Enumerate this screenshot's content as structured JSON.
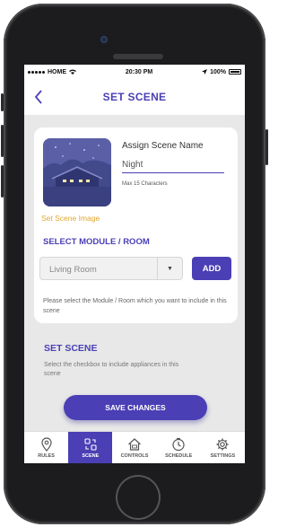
{
  "status_bar": {
    "carrier": "HOME",
    "time": "20:30 PM",
    "battery": "100%"
  },
  "header": {
    "title": "SET SCENE",
    "back_icon": "chevron-left-icon"
  },
  "scene_card": {
    "image_label": "Set Scene Image",
    "assign_label": "Assign Scene Name",
    "name_value": "Night",
    "max_hint": "Max 15 Characters",
    "module_heading": "SELECT MODULE / ROOM",
    "room_selected": "Living Room",
    "add_label": "ADD",
    "hint": "Please select the Module / Room which you want to include in this scene"
  },
  "set_scene": {
    "heading": "SET SCENE",
    "hint": "Select the checkbox to include appliances in this scene"
  },
  "save_label": "SAVE CHANGES",
  "tabs": [
    {
      "label": "RULES",
      "icon": "map-pin-icon",
      "active": false
    },
    {
      "label": "SCENE",
      "icon": "scene-icon",
      "active": true
    },
    {
      "label": "CONTROLS",
      "icon": "house-icon",
      "active": false
    },
    {
      "label": "SCHEDULE",
      "icon": "clock-icon",
      "active": false
    },
    {
      "label": "SETTINGS",
      "icon": "gear-icon",
      "active": false
    }
  ],
  "colors": {
    "accent": "#4a3fb5",
    "image_label": "#e0a82e",
    "screen_bg": "#e8e8e8"
  }
}
